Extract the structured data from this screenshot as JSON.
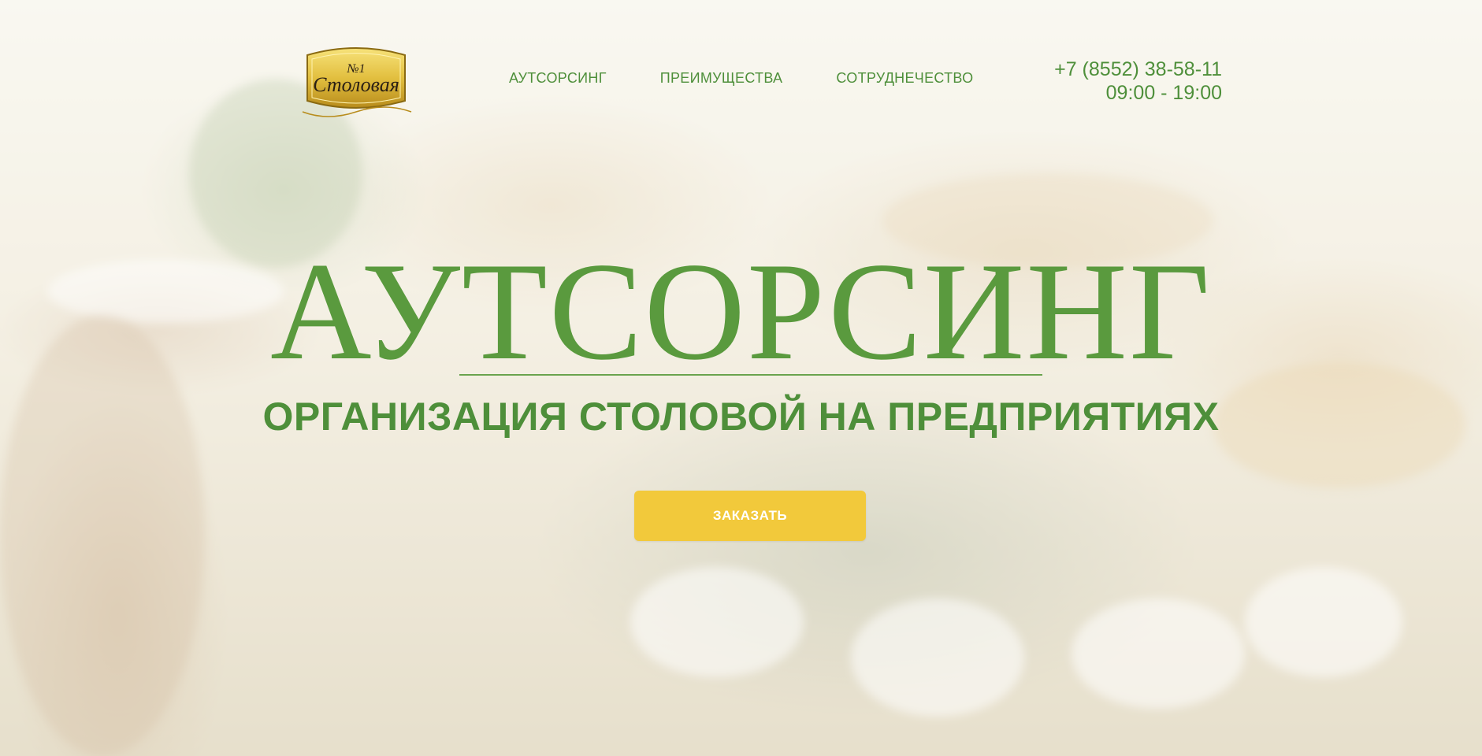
{
  "logo": {
    "number": "№1",
    "text": "Столовая"
  },
  "nav": {
    "items": [
      {
        "label": "АУТСОРСИНГ"
      },
      {
        "label": "ПРЕИМУЩЕСТВА"
      },
      {
        "label": "СОТРУДНЕЧЕСТВО"
      }
    ]
  },
  "contacts": {
    "phone": "+7 (8552) 38-58-11",
    "hours": "09:00 - 19:00"
  },
  "hero": {
    "title": "АУТСОРСИНГ",
    "subtitle": "ОРГАНИЗАЦИЯ СТОЛОВОЙ НА ПРЕДПРИЯТИЯХ",
    "cta_label": "ЗАКАЗАТЬ"
  },
  "colors": {
    "accent_green": "#4e8f3a",
    "button_yellow": "#f2c93b",
    "logo_gold": "#d9b53a"
  }
}
